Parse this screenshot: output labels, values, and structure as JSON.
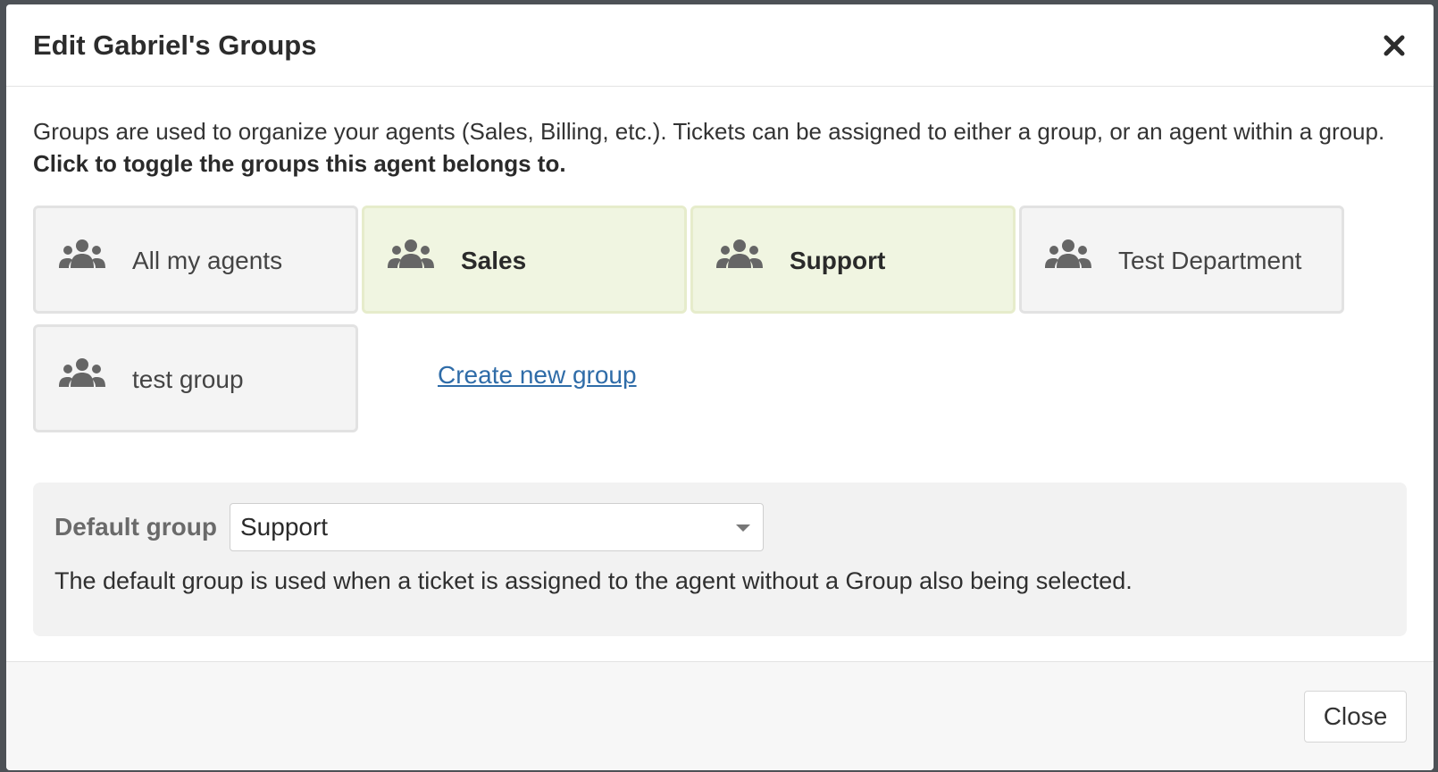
{
  "dialog": {
    "title": "Edit Gabriel's Groups",
    "close_icon": "close-icon"
  },
  "intro": {
    "text": "Groups are used to organize your agents (Sales, Billing, etc.). Tickets can be assigned to either a group, or an agent within a group. ",
    "emphasis": "Click to toggle the groups this agent belongs to."
  },
  "groups": [
    {
      "name": "All my agents",
      "selected": false,
      "icon": "group-icon"
    },
    {
      "name": "Sales",
      "selected": true,
      "icon": "group-icon"
    },
    {
      "name": "Support",
      "selected": true,
      "icon": "group-icon"
    },
    {
      "name": "Test Department",
      "selected": false,
      "icon": "group-icon"
    },
    {
      "name": "test group",
      "selected": false,
      "icon": "group-icon"
    }
  ],
  "create_link": "Create new group",
  "default_group": {
    "label": "Default group",
    "selected_value": "Support",
    "help": "The default group is used when a ticket is assigned to the agent without a Group also being selected."
  },
  "footer": {
    "close_label": "Close"
  },
  "colors": {
    "selected_bg": "#f0f5e1",
    "unselected_bg": "#f4f4f4",
    "link": "#2f6ca8"
  }
}
